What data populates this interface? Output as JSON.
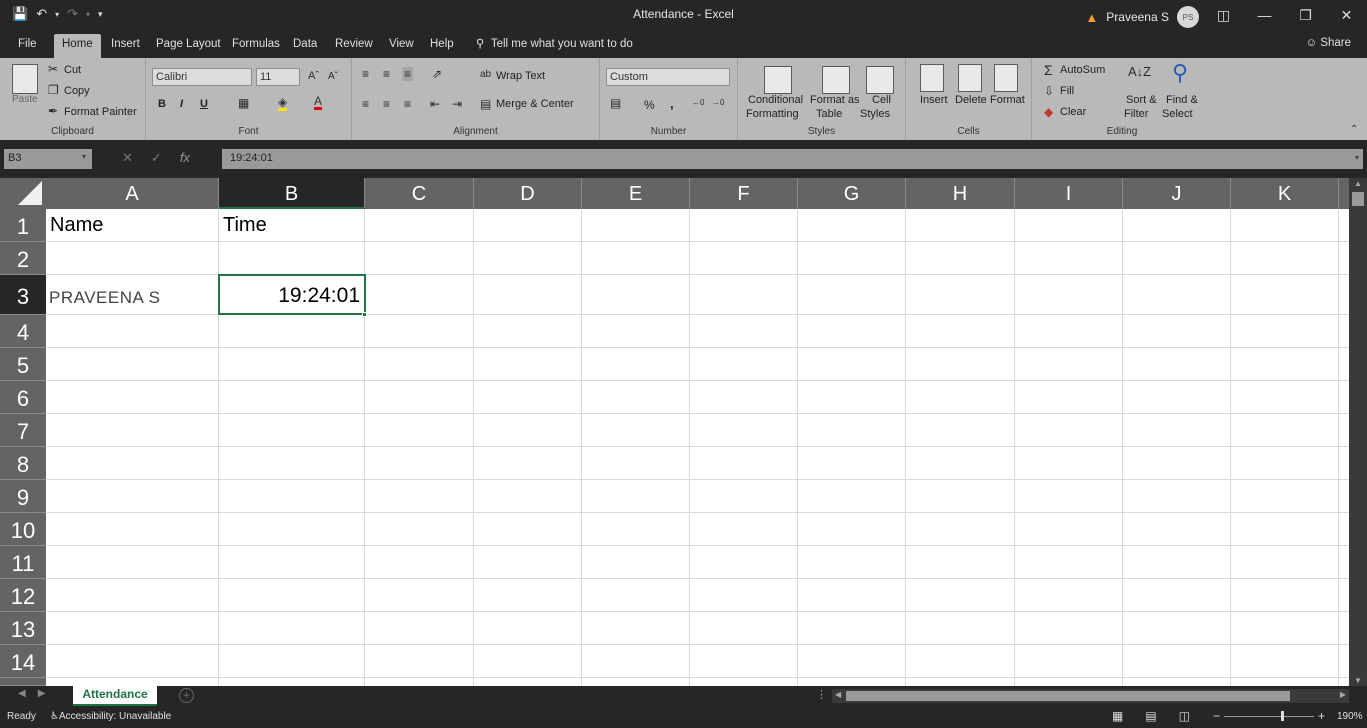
{
  "window": {
    "title": "Attendance  -  Excel",
    "user_name": "Praveena S",
    "user_initials": "PS"
  },
  "menu": {
    "tabs": [
      "File",
      "Home",
      "Insert",
      "Page Layout",
      "Formulas",
      "Data",
      "Review",
      "View",
      "Help"
    ],
    "active_tab": "Home",
    "tell_me": "Tell me what you want to do",
    "share": "Share"
  },
  "ribbon": {
    "clipboard": {
      "paste": "Paste",
      "cut": "Cut",
      "copy": "Copy",
      "format_painter": "Format Painter",
      "label": "Clipboard"
    },
    "font": {
      "name": "Calibri",
      "size": "11",
      "bold": "B",
      "italic": "I",
      "underline": "U",
      "label": "Font"
    },
    "alignment": {
      "wrap_text": "Wrap Text",
      "merge_center": "Merge & Center",
      "label": "Alignment"
    },
    "number": {
      "format": "Custom",
      "percent": "%",
      "comma": ",",
      "label": "Number"
    },
    "styles": {
      "conditional": "Conditional",
      "conditional2": "Formatting",
      "format_as": "Format as",
      "format_as2": "Table",
      "cell": "Cell",
      "cell2": "Styles",
      "label": "Styles"
    },
    "cells": {
      "insert": "Insert",
      "delete": "Delete",
      "format": "Format",
      "label": "Cells"
    },
    "editing": {
      "autosum": "AutoSum",
      "fill": "Fill",
      "clear": "Clear",
      "sort": "Sort &",
      "sort2": "Filter",
      "find": "Find &",
      "find2": "Select",
      "label": "Editing"
    }
  },
  "formula_bar": {
    "name_box": "B3",
    "formula": "19:24:01"
  },
  "grid": {
    "columns": [
      "A",
      "B",
      "C",
      "D",
      "E",
      "F",
      "G",
      "H",
      "I",
      "J",
      "K"
    ],
    "selected_column": "B",
    "rows": [
      "1",
      "2",
      "3",
      "4",
      "5",
      "6",
      "7",
      "8",
      "9",
      "10",
      "11",
      "12",
      "13",
      "14"
    ],
    "selected_row": "3",
    "cells": {
      "A1": "Name",
      "B1": "Time",
      "A3": "PRAVEENA  S",
      "B3": "19:24:01"
    }
  },
  "sheets": {
    "active": "Attendance"
  },
  "status": {
    "ready": "Ready",
    "accessibility": "Accessibility: Unavailable",
    "zoom": "190%"
  }
}
